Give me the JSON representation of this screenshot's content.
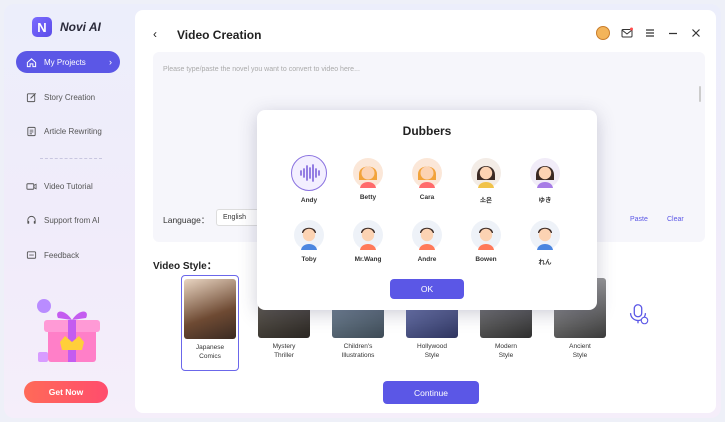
{
  "app": {
    "logo_letter": "N",
    "name": "Novi AI"
  },
  "sidebar": {
    "items": [
      {
        "label": "My Projects",
        "icon": "home-icon",
        "active": true
      },
      {
        "label": "Story Creation",
        "icon": "edit-icon",
        "active": false
      },
      {
        "label": "Article Rewriting",
        "icon": "document-icon",
        "active": false
      },
      {
        "label": "Video Tutorial",
        "icon": "video-icon",
        "active": false
      },
      {
        "label": "Support from AI",
        "icon": "headset-icon",
        "active": false
      },
      {
        "label": "Feedback",
        "icon": "feedback-icon",
        "active": false
      }
    ],
    "get_now_label": "Get Now"
  },
  "header": {
    "back_glyph": "‹",
    "title": "Video Creation"
  },
  "editor": {
    "placeholder": "Please type/paste the novel you want to convert to video here...",
    "language_label": "Language：",
    "language_value": "English",
    "paste_label": "Paste",
    "clear_label": "Clear"
  },
  "video_style": {
    "label": "Video Style：",
    "styles": [
      {
        "lines": [
          "Japanese",
          "Comics"
        ],
        "selected": true
      },
      {
        "lines": [
          "Mystery",
          "Thriller"
        ],
        "selected": false
      },
      {
        "lines": [
          "Children's",
          "Illustrations"
        ],
        "selected": false
      },
      {
        "lines": [
          "Hollywood",
          "Style"
        ],
        "selected": false
      },
      {
        "lines": [
          "Modern",
          "Style"
        ],
        "selected": false
      },
      {
        "lines": [
          "Ancient",
          "Style"
        ],
        "selected": false
      }
    ]
  },
  "continue_label": "Continue",
  "dialog": {
    "title": "Dubbers",
    "dubbers": [
      {
        "name": "Andy",
        "selected": true,
        "kind": "wave"
      },
      {
        "name": "Betty",
        "selected": false,
        "kind": "female"
      },
      {
        "name": "Cara",
        "selected": false,
        "kind": "female"
      },
      {
        "name": "소은",
        "selected": false,
        "kind": "female-dark"
      },
      {
        "name": "ゆき",
        "selected": false,
        "kind": "female-dark"
      },
      {
        "name": "Toby",
        "selected": false,
        "kind": "male-blue"
      },
      {
        "name": "Mr.Wang",
        "selected": false,
        "kind": "male"
      },
      {
        "name": "Andre",
        "selected": false,
        "kind": "male"
      },
      {
        "name": "Bowen",
        "selected": false,
        "kind": "male"
      },
      {
        "name": "れん",
        "selected": false,
        "kind": "male-blue"
      }
    ],
    "ok_label": "OK"
  },
  "colors": {
    "accent": "#5b57e6",
    "get_now": "#ff5a60"
  }
}
